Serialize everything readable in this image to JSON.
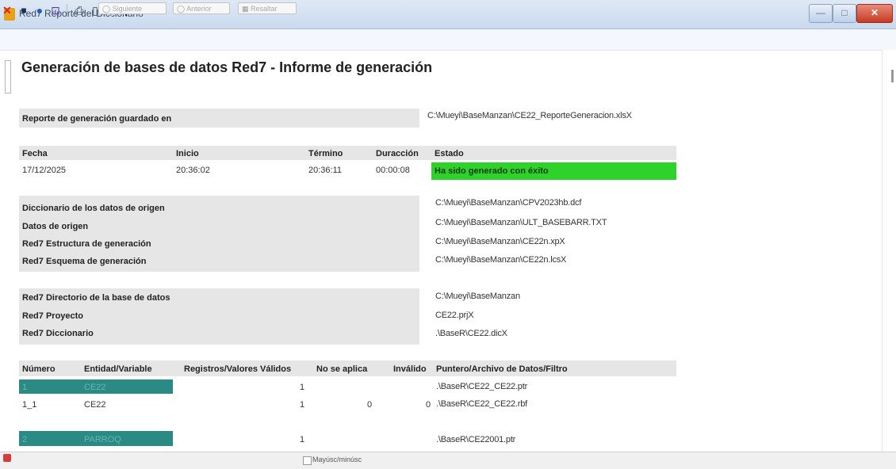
{
  "window": {
    "title": "Red7 Reporte del Diccionario",
    "min": "—",
    "max": "□",
    "close": "✕"
  },
  "toolbar": {
    "close": "✕",
    "save": "■",
    "globe": "●",
    "export": "⊡",
    "print": "⎙",
    "preview": "▯",
    "find": "⚲"
  },
  "report": {
    "title": "Generación de bases de datos Red7 - Informe de generación",
    "saved_label": "Reporte de generación guardado en",
    "saved_path": "C:\\Mueyi\\BaseManzan\\CE22_ReporteGeneracion.xlsX",
    "headers": {
      "fecha": "Fecha",
      "inicio": "Inicio",
      "termino": "Término",
      "duracion": "Duracción",
      "estado": "Estado"
    },
    "row": {
      "fecha": "17/12/2025",
      "inicio": "20:36:02",
      "termino": "20:36:11",
      "duracion": "00:00:08",
      "estado": "Ha sido generado con éxito"
    },
    "status_color": "#2fd22a",
    "sources": [
      {
        "label": "Diccionario de los datos de origen",
        "value": "C:\\Mueyi\\BaseManzan\\CPV2023hb.dcf"
      },
      {
        "label": "Datos de origen",
        "value": "C:\\Mueyi\\BaseManzan\\ULT_BASEBARR.TXT"
      },
      {
        "label": "Red7 Estructura de generación",
        "value": "C:\\Mueyi\\BaseManzan\\CE22n.xpX"
      },
      {
        "label": "Red7 Esquema de generación",
        "value": "C:\\Mueyi\\BaseManzan\\CE22n.lcsX"
      }
    ],
    "project": [
      {
        "label": "Red7 Directorio de la base de datos",
        "value": "C:\\Mueyi\\BaseManzan"
      },
      {
        "label": "Red7 Proyecto",
        "value": "CE22.prjX"
      },
      {
        "label": "Red7 Diccionario",
        "value": ".\\BaseR\\CE22.dicX"
      }
    ],
    "entity_headers": {
      "numero": "Número",
      "entidad": "Entidad/Variable",
      "registros": "Registros/Valores Válidos",
      "noaplica": "No se aplica",
      "invalido": "Inválido",
      "puntero": "Puntero/Archivo de Datos/Filtro"
    },
    "entities": [
      {
        "numero": "1",
        "entidad": "CE22",
        "registros": "1",
        "noaplica": "",
        "invalido": "",
        "puntero": ".\\BaseR\\CE22_CE22.ptr"
      },
      {
        "numero": "1_1",
        "entidad": "CE22",
        "registros": "1",
        "noaplica": "0",
        "invalido": "0",
        "puntero": ".\\BaseR\\CE22_CE22.rbf"
      },
      {
        "numero": "2",
        "entidad": "PARROQ",
        "registros": "1",
        "noaplica": "",
        "invalido": "",
        "puntero": ".\\BaseR\\CE22001.ptr"
      }
    ],
    "teal_color": "#2c8a85"
  },
  "statusbar": {
    "search_input_value": "",
    "next": "Siguiente",
    "prev": "Anterior",
    "highlight": "Resaltar",
    "match_case": "Mayúsc/minúsc"
  }
}
